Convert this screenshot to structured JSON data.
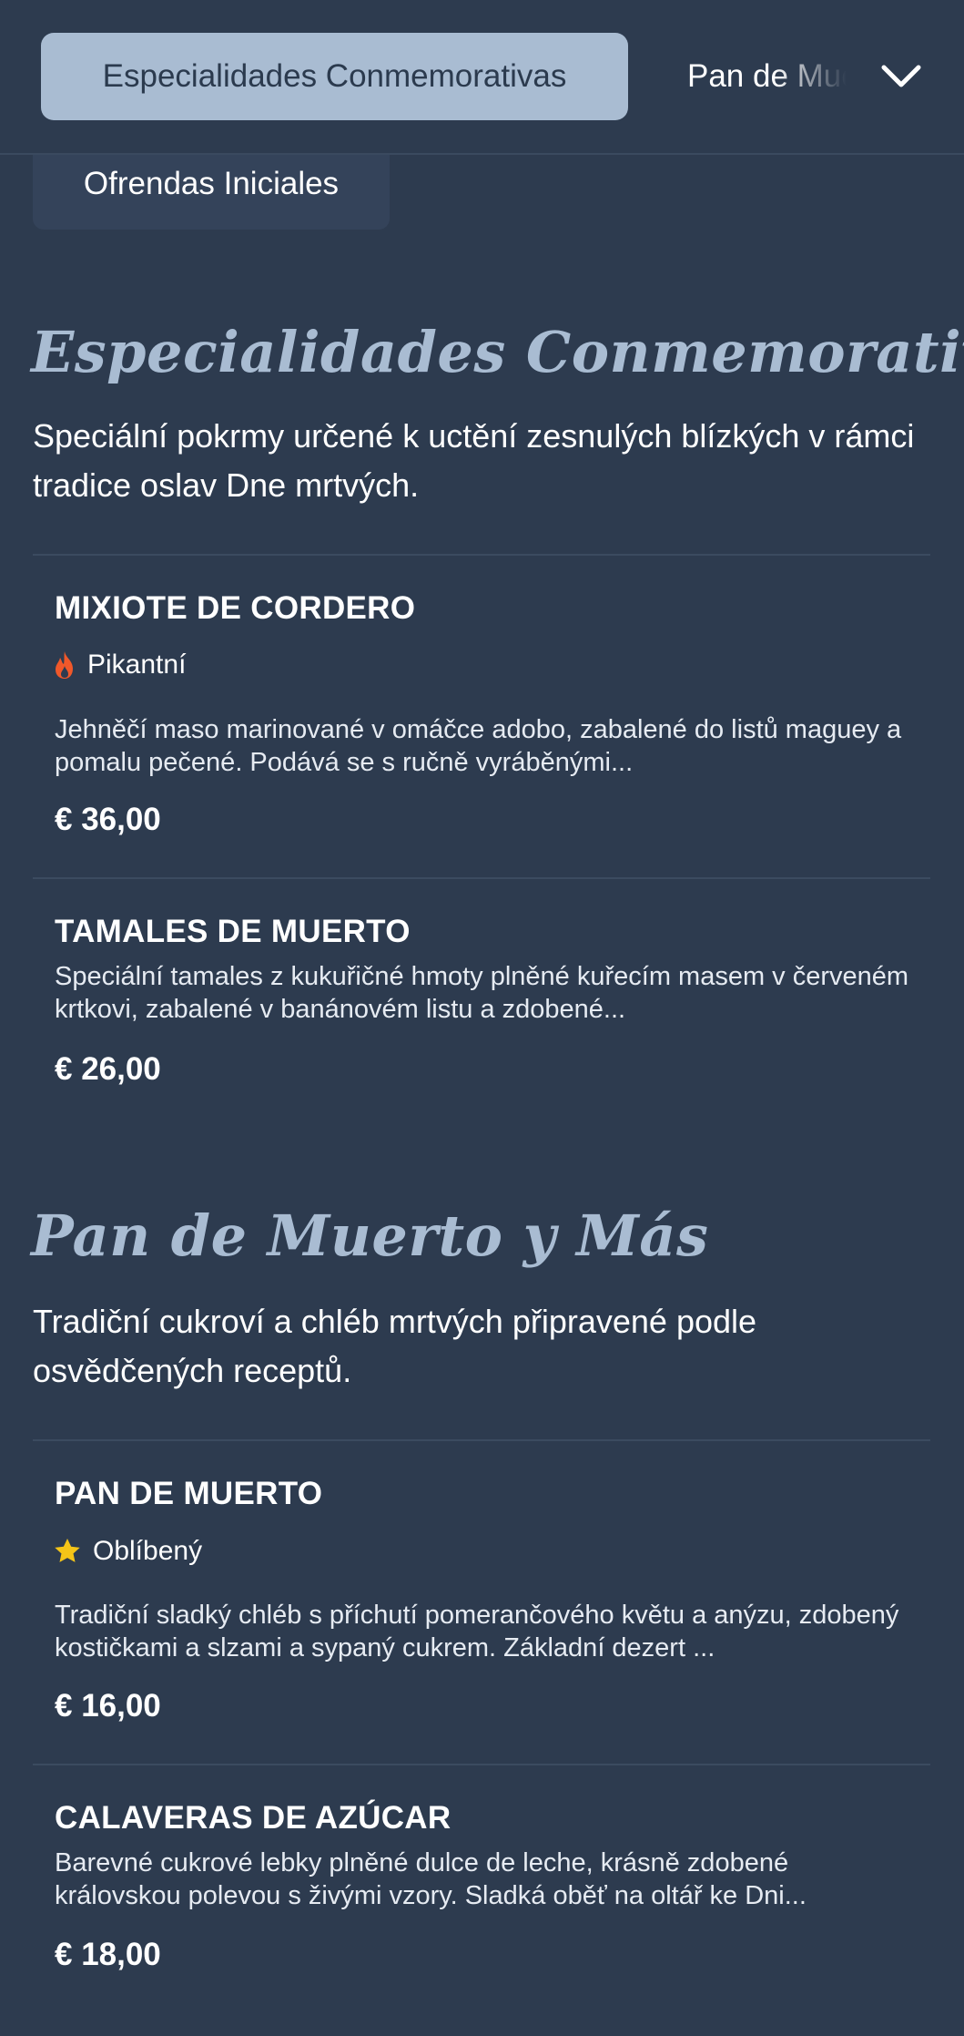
{
  "nav": {
    "active_tab": "Especialidades Conmemorativas",
    "next_tab": "Pan de Muerto y Más",
    "prev_tab": "Ofrendas Iniciales",
    "expand_icon": "chevron-down-icon"
  },
  "sections": [
    {
      "title": "Especialidades Conmemorativas",
      "description": "Speciální pokrmy určené k uctění zesnulých blízkých v rámci tradice oslav Dne mrtvých.",
      "items": [
        {
          "name": "MIXIOTE DE CORDERO",
          "badge": "Pikantní",
          "badge_icon": "flame-icon",
          "description": "Jehněčí maso marinované v omáčce adobo, zabalené do listů maguey a pomalu pečené. Podává se s ručně vyráběnými...",
          "price": "€ 36,00"
        },
        {
          "name": "TAMALES DE MUERTO",
          "description": "Speciální tamales z kukuřičné hmoty plněné kuřecím masem v červeném krtkovi, zabalené v banánovém listu a zdobené...",
          "price": "€ 26,00"
        }
      ]
    },
    {
      "title": "Pan de Muerto y Más",
      "description": "Tradiční cukroví a chléb mrtvých připravené podle osvědčených receptů.",
      "items": [
        {
          "name": "PAN DE MUERTO",
          "badge": "Oblíbený",
          "badge_icon": "star-icon",
          "description": "Tradiční sladký chléb s příchutí pomerančového květu a anýzu, zdobený kostičkami a slzami a sypaný cukrem. Základní dezert ...",
          "price": "€ 16,00"
        },
        {
          "name": "CALAVERAS DE AZÚCAR",
          "description": "Barevné cukrové lebky plněné dulce de leche, krásně zdobené královskou polevou s živými vzory. Sladká oběť na oltář ke Dni...",
          "price": "€ 18,00"
        }
      ]
    }
  ],
  "colors": {
    "background": "#2d3b4f",
    "accent": "#a9bcd2",
    "flame": "#f0582a",
    "star": "#f5c518"
  }
}
